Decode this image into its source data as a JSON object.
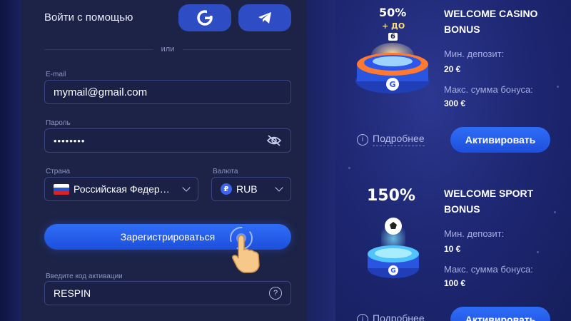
{
  "login": {
    "label": "Войти с помощью",
    "google_icon": "google-icon",
    "telegram_icon": "telegram-icon",
    "or_text": "или"
  },
  "form": {
    "email_label": "E-mail",
    "email_value": "mymail@gmail.com",
    "password_label": "Пароль",
    "password_value": "••••••••",
    "country_label": "Страна",
    "country_value": "Российская Федер…",
    "currency_label": "Валюта",
    "currency_symbol": "₽",
    "currency_value": "RUB",
    "register_label": "Зарегистрироваться",
    "promo_label": "Введите код активации",
    "promo_value": "RESPIN",
    "help_symbol": "?"
  },
  "bonuses": [
    {
      "percent": "50%",
      "extra": "+ ДО",
      "extra_small": "6",
      "title": "WELCOME CASINO BONUS",
      "min_deposit_label": "Мин. депозит:",
      "min_deposit_value": "20 €",
      "max_bonus_label": "Макс. сумма бонуса:",
      "max_bonus_value": "300 €",
      "more_label": "Подробнее",
      "activate_label": "Активировать"
    },
    {
      "percent": "150%",
      "title": "WELCOME SPORT BONUS",
      "min_deposit_label": "Мин. депозит:",
      "min_deposit_value": "10 €",
      "max_bonus_label": "Макс. сумма бонуса:",
      "max_bonus_value": "100 €",
      "more_label": "Подробнее",
      "activate_label": "Активировать"
    }
  ],
  "colors": {
    "accent": "#2f6df7",
    "panel": "#1c2347",
    "background": "#141a4a"
  }
}
